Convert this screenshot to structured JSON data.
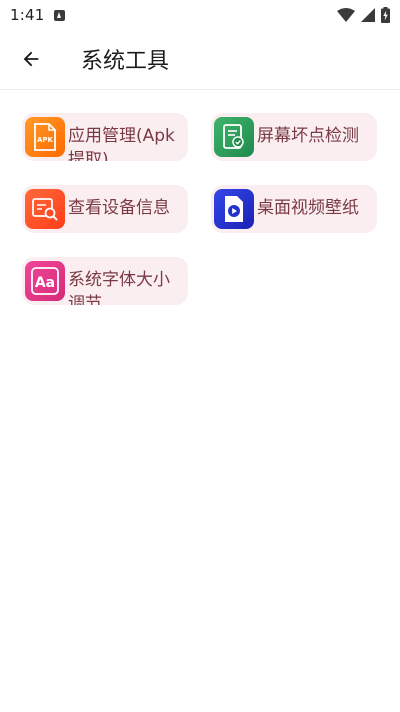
{
  "status_bar": {
    "time": "1:41"
  },
  "app_bar": {
    "title": "系统工具",
    "back_icon": "arrow-back-icon"
  },
  "tools": [
    {
      "label": "应用管理(Apk提取)",
      "icon": "apk-icon",
      "color": "#ff7f00"
    },
    {
      "label": "屏幕坏点检测",
      "icon": "document-check-icon",
      "color": "#2e9a5a"
    },
    {
      "label": "查看设备信息",
      "icon": "search-info-icon",
      "color": "#ff4a1f"
    },
    {
      "label": "桌面视频壁纸",
      "icon": "video-file-icon",
      "color": "#2233cc"
    },
    {
      "label": "系统字体大小调节",
      "icon": "font-aa-icon",
      "color": "#e6308a"
    }
  ],
  "colors": {
    "card_bg": "#fbeef0",
    "card_text": "#7a3a44"
  }
}
